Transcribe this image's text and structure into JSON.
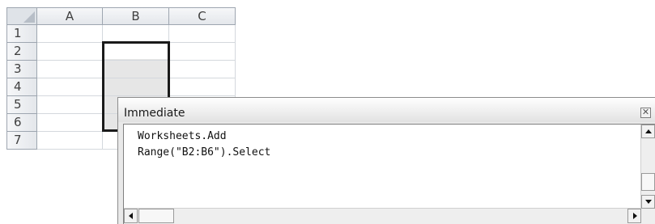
{
  "spreadsheet": {
    "columns": [
      "A",
      "B",
      "C"
    ],
    "rows": [
      "1",
      "2",
      "3",
      "4",
      "5",
      "6",
      "7"
    ],
    "selected_range": "B2:B6"
  },
  "immediate_window": {
    "title": "Immediate",
    "close_glyph": "✕",
    "lines": [
      "Worksheets.Add",
      "Range(\"B2:B6\").Select"
    ]
  },
  "icons": {
    "close": "close-icon",
    "scroll_up": "arrow-up-icon",
    "scroll_down": "arrow-down-icon",
    "scroll_left": "arrow-left-icon",
    "scroll_right": "arrow-right-icon"
  }
}
